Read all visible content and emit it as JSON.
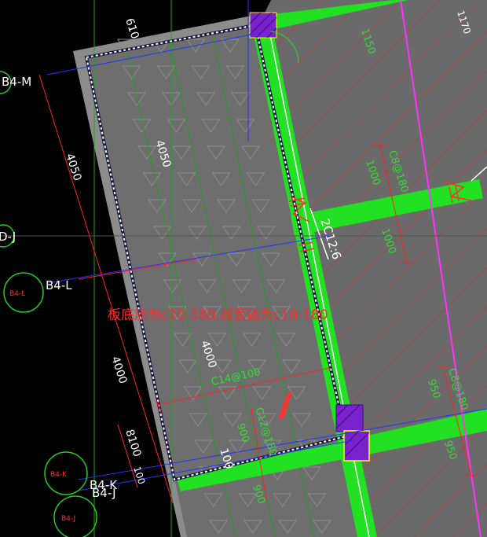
{
  "axes": {
    "b4m": "B4-M",
    "b4l": "B4-L",
    "b4k": "B4-K",
    "b4j": "B4-J",
    "dj": "D-J",
    "circle_b4l": "B4-L",
    "circle_b4k": "B4-K",
    "circle_b4j": "B4-J"
  },
  "dims": {
    "d4050_left": "4050",
    "d4050_slab": "4050",
    "d4000_left": "4000",
    "d4000_slab": "4000",
    "d8100": "8100",
    "d100_left": "100",
    "d100_slab": "100",
    "d610": "610",
    "d1150": "1150",
    "d1170": "1170",
    "d1000_a": "1000",
    "d1000_b": "1000",
    "d950_a": "950",
    "d950_b": "950",
    "d900_a": "900",
    "d900_b": "900"
  },
  "rebar": {
    "c8_180_upper": "C8@180",
    "c8_180_lower": "C8@180",
    "c14_100": "C14@100",
    "c12_180": "C12@180",
    "two_c12_6": "2C12:6"
  },
  "note": "板底筋为c10-180,板面筋为c10-180",
  "colors": {
    "slab": "#7a7a7a",
    "beam": "#22e022",
    "hatch": "#b84040",
    "column": "#7a22cc",
    "dim": "#ff2020",
    "axis": "#2233ff",
    "magenta": "#ff33ff"
  }
}
